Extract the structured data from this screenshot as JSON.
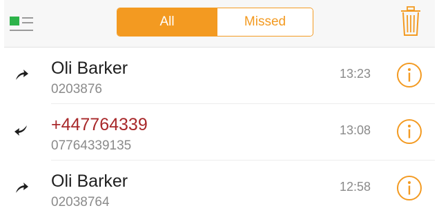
{
  "colors": {
    "accent": "#f39a21",
    "missed": "#a8282a",
    "list_icon_green": "#2db34a"
  },
  "toolbar": {
    "list_icon": "list-view-icon",
    "segments": {
      "all_label": "All",
      "missed_label": "Missed"
    },
    "trash_icon": "trash-icon"
  },
  "calls": [
    {
      "direction": "outgoing",
      "name": "Oli Barker",
      "number": "0203876",
      "time": "13:23",
      "missed": false
    },
    {
      "direction": "incoming",
      "name": "+447764339",
      "number": "07764339135",
      "time": "13:08",
      "missed": true
    },
    {
      "direction": "outgoing",
      "name": "Oli Barker",
      "number": "02038764",
      "time": "12:58",
      "missed": false
    }
  ]
}
